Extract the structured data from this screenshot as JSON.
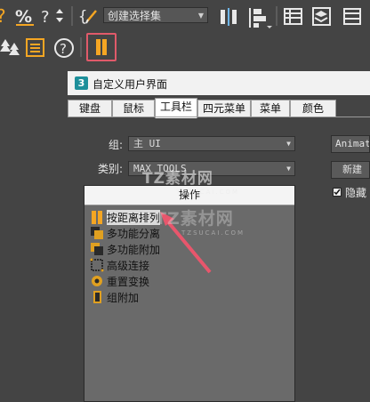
{
  "toolbar": {
    "named_selection_sets": "创建选择集",
    "icons_row1": [
      "help-icon",
      "percent-snap-icon",
      "spinner-snap-icon",
      "edit-named-sets-icon",
      "mirror-icon",
      "align-icon",
      "scene-explorer-icon",
      "layer-explorer-icon"
    ],
    "icons_row2": [
      "tree-icon",
      "list-icon",
      "help-circle-icon",
      "distance-array-icon"
    ]
  },
  "dialog": {
    "title": "自定义用户界面",
    "tabs": [
      "键盘",
      "鼠标",
      "工具栏",
      "四元菜单",
      "菜单",
      "颜色"
    ],
    "active_tab": "工具栏",
    "group_label": "组:",
    "group_value": "主 UI",
    "category_label": "类别:",
    "category_value": "MAX TOOLS",
    "list_header": "操作",
    "actions": [
      {
        "label": "按距离排列",
        "icon": "distance-array-icon"
      },
      {
        "label": "多功能分离",
        "icon": "detach-icon"
      },
      {
        "label": "多功能附加",
        "icon": "attach-icon"
      },
      {
        "label": "高级连接",
        "icon": "advanced-connect-icon"
      },
      {
        "label": "重置变换",
        "icon": "reset-xform-icon"
      },
      {
        "label": "组附加",
        "icon": "group-attach-icon"
      }
    ],
    "right_combo": "Animati",
    "new_button": "新建",
    "hide_checkbox_label": "隐藏",
    "hide_checked": true
  },
  "watermark": {
    "text": "TZ素材网",
    "sub": "TZSUCAI.COM"
  },
  "colors": {
    "accent_orange": "#f5a623",
    "annotation_arrow": "#e8566c",
    "highlight_border": "#e05a6a"
  }
}
